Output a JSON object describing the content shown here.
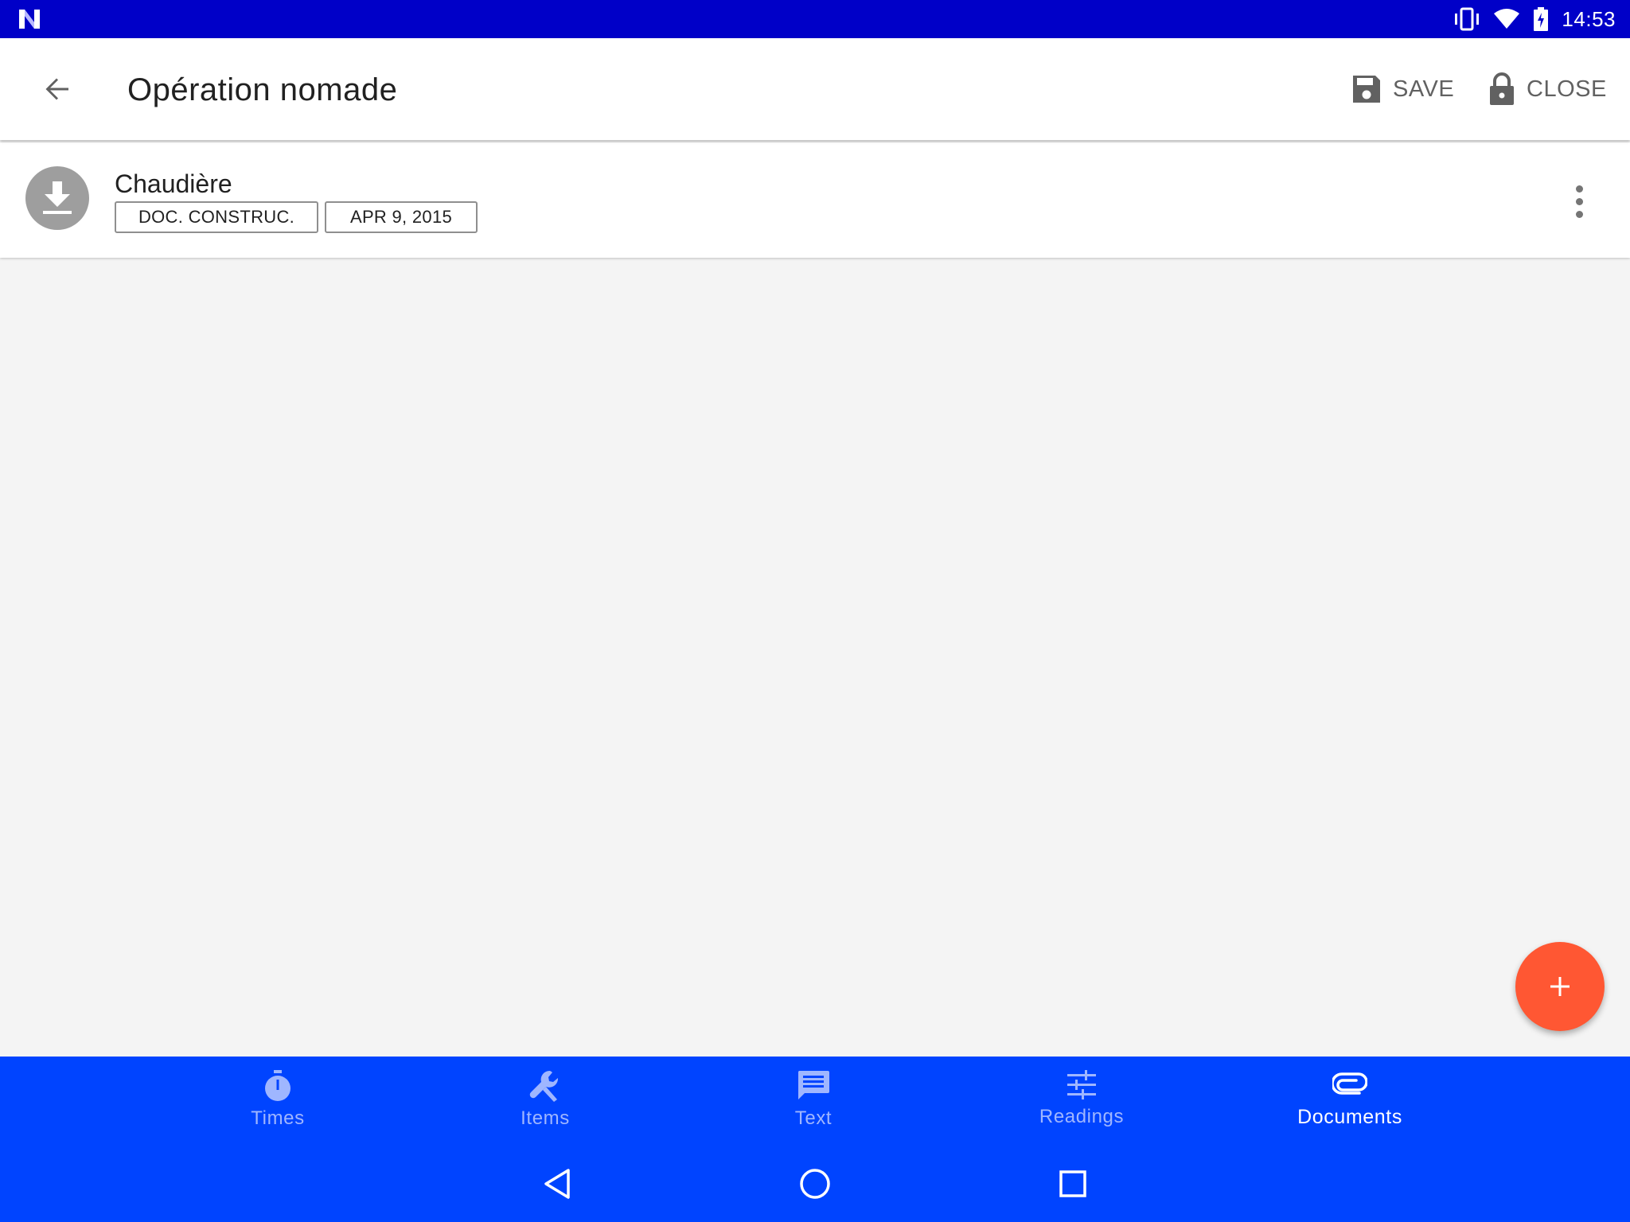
{
  "status_bar": {
    "time": "14:53"
  },
  "app_bar": {
    "title": "Opération nomade",
    "save_label": "SAVE",
    "close_label": "CLOSE"
  },
  "document": {
    "name": "Chaudière",
    "category": "DOC. CONSTRUC.",
    "date": "APR 9, 2015"
  },
  "bottom_nav": {
    "items": [
      {
        "label": "Times",
        "icon": "timer-icon"
      },
      {
        "label": "Items",
        "icon": "wrench-icon"
      },
      {
        "label": "Text",
        "icon": "message-icon"
      },
      {
        "label": "Readings",
        "icon": "tune-icon"
      },
      {
        "label": "Documents",
        "icon": "attachment-icon",
        "active": true
      }
    ]
  },
  "colors": {
    "status_bar": "#0000c8",
    "bottom_nav": "#0044ff",
    "fab": "#ff5733",
    "nav_inactive": "#9fb6ff"
  }
}
